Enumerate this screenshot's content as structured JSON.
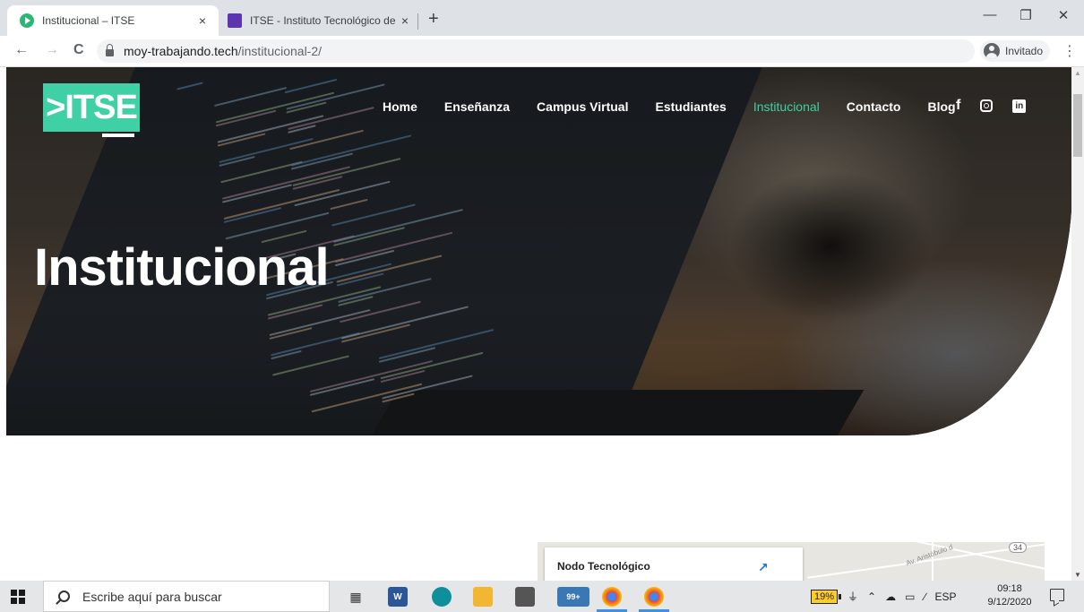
{
  "browser": {
    "tabs": [
      {
        "title": "Institucional – ITSE",
        "close": "×"
      },
      {
        "title": "ITSE - Instituto Tecnológico de Sa",
        "close": "×"
      }
    ],
    "new_tab": "+",
    "window_controls": {
      "minimize": "—",
      "restore": "❐",
      "close": "✕"
    },
    "back": "←",
    "forward": "→",
    "reload": "C",
    "url_host": "moy-trabajando.tech",
    "url_path": "/institucional-2/",
    "profile_label": "Invitado",
    "menu": "⋮"
  },
  "site": {
    "logo_text": ">ITSE",
    "nav": [
      "Home",
      "Enseñanza",
      "Campus Virtual",
      "Estudiantes",
      "Institucional",
      "Contacto",
      "Blog"
    ],
    "active_nav": "Institucional",
    "social": {
      "facebook": "f",
      "linkedin": "in"
    },
    "hero_title": "Institucional",
    "accent_color": "#3fd0a5"
  },
  "map": {
    "place_name": "Nodo Tecnológico",
    "route_badge": "34",
    "street_label": "Av. Aristóbulo d"
  },
  "taskbar": {
    "search_placeholder": "Escribe aquí para buscar",
    "mail_badge": "99+",
    "battery_percent": "19%",
    "language": "ESP",
    "time": "09:18",
    "date": "9/12/2020"
  }
}
